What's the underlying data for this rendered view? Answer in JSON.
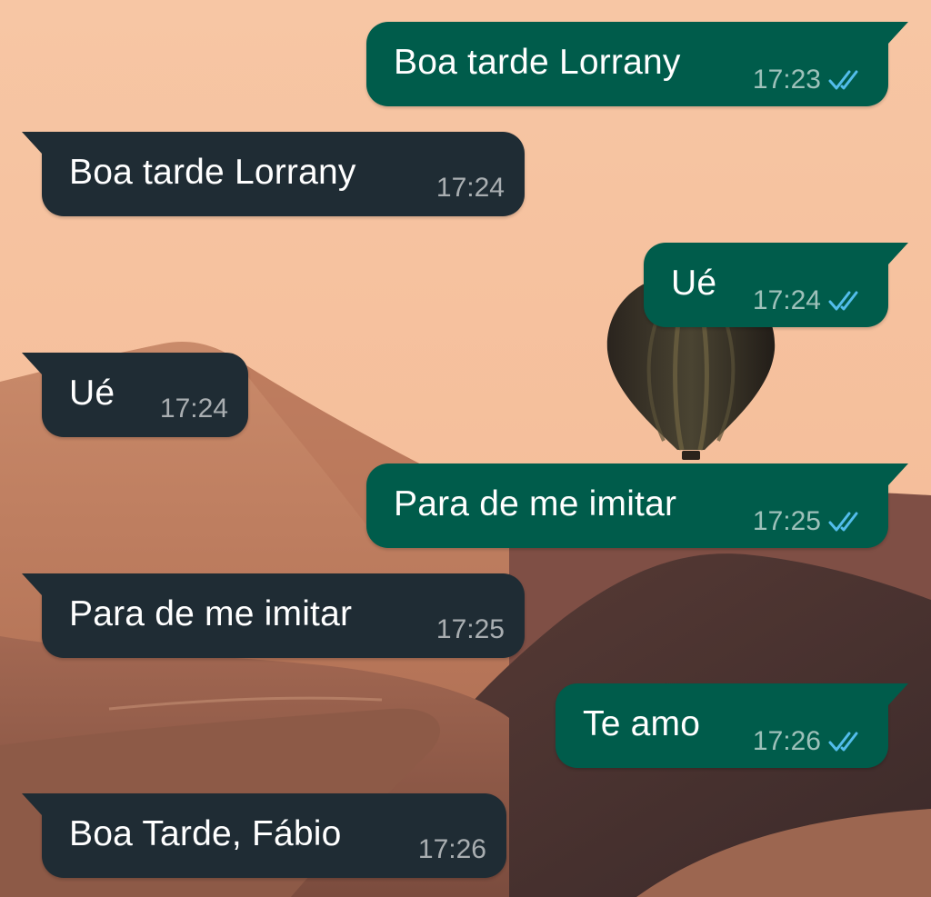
{
  "colors": {
    "outgoing_bubble": "#005c4b",
    "incoming_bubble": "#1f2c34",
    "text": "#ffffff",
    "time_text": "#aebfbc",
    "read_check": "#53bdeb",
    "sky": "#f6c3a0"
  },
  "wallpaper": {
    "description_icon": "hot-air-balloon-desert-icon"
  },
  "messages": [
    {
      "direction": "outgoing",
      "text": "Boa tarde Lorrany",
      "time": "17:23",
      "status": "read"
    },
    {
      "direction": "incoming",
      "text": "Boa tarde Lorrany",
      "time": "17:24"
    },
    {
      "direction": "outgoing",
      "text": "Ué",
      "time": "17:24",
      "status": "read"
    },
    {
      "direction": "incoming",
      "text": "Ué",
      "time": "17:24"
    },
    {
      "direction": "outgoing",
      "text": "Para de me imitar",
      "time": "17:25",
      "status": "read"
    },
    {
      "direction": "incoming",
      "text": "Para de me imitar",
      "time": "17:25"
    },
    {
      "direction": "outgoing",
      "text": "Te amo",
      "time": "17:26",
      "status": "read"
    },
    {
      "direction": "incoming",
      "text": "Boa Tarde, Fábio",
      "time": "17:26"
    }
  ]
}
